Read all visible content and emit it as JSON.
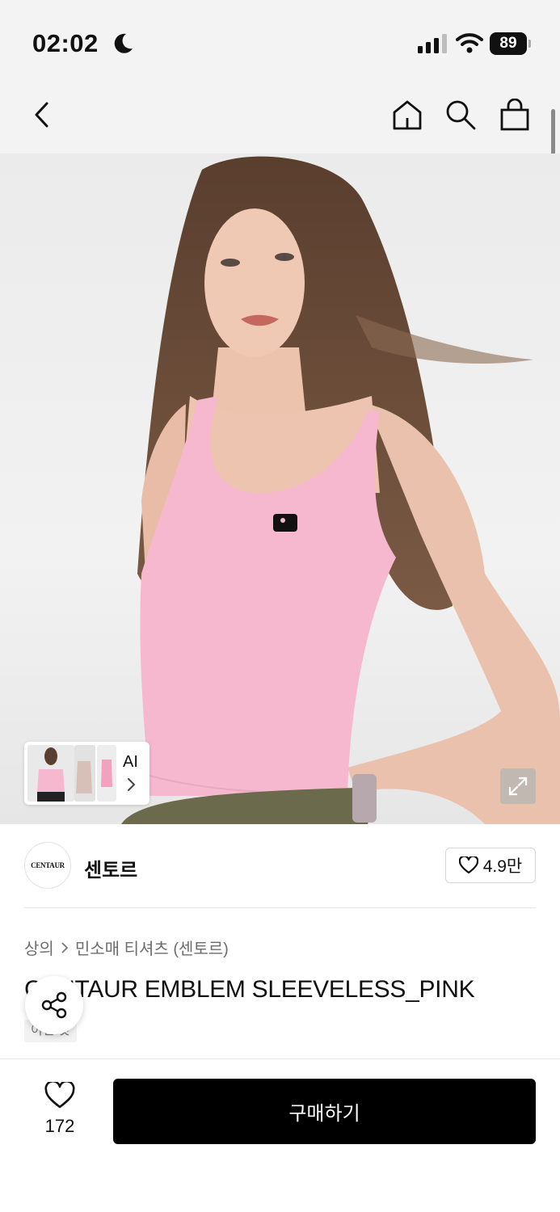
{
  "status": {
    "time": "02:02",
    "battery": "89"
  },
  "nav": {
    "back_icon": "chevron-left-icon",
    "home_icon": "home-icon",
    "search_icon": "search-icon",
    "bag_icon": "shopping-bag-icon"
  },
  "gallery": {
    "ai_label": "AI"
  },
  "brand": {
    "logo_text": "CENTAUR",
    "name": "센토르",
    "likes": "4.9만"
  },
  "breadcrumb": {
    "category": "상의",
    "subcategory": "민소매 티셔츠 (센토르)"
  },
  "product": {
    "title": "CENTAUR EMBLEM SLEEVELESS_PINK",
    "tag": "이번 것"
  },
  "footer": {
    "wish_count": "172",
    "buy_label": "구매하기"
  },
  "colors": {
    "accent": "#000000",
    "garment": "#f6b8cf",
    "pants": "#6b6a4c"
  }
}
